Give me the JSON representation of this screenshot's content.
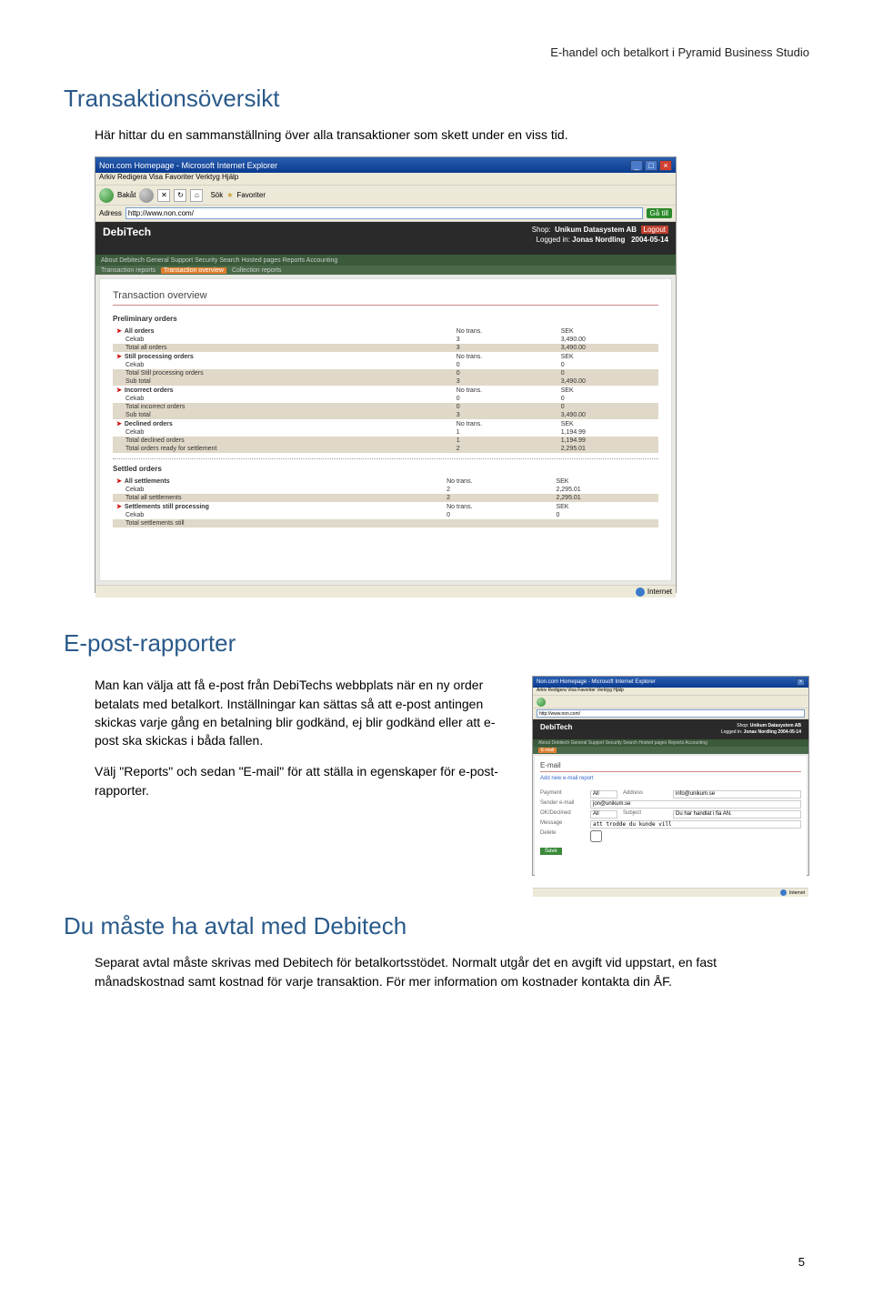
{
  "header_line": "E-handel och betalkort i Pyramid Business Studio",
  "section1": {
    "title": "Transaktionsöversikt",
    "body": "Här hittar du en sammanställning över alla transaktioner som skett under en viss tid."
  },
  "ie_window": {
    "title": "Non.com Homepage - Microsoft Internet Explorer",
    "menubar": "Arkiv  Redigera  Visa  Favoriter  Verktyg  Hjälp",
    "back": "Bakåt",
    "search": "Sök",
    "fav": "Favoriter",
    "address_label": "Adress",
    "address": "http://www.non.com/",
    "go": "Gå till",
    "status_net": "Internet"
  },
  "debitech": {
    "logo": "DebiTech",
    "shop_label": "Shop:",
    "shop": "Unikum Datasystem AB",
    "login_label": "Logged in:",
    "login": "Jonas Nordling",
    "date": "2004-05-14",
    "logout": "Logout",
    "nav": "About Debitech   General   Support   Security   Search   Hosted pages   Reports   Accounting",
    "subnav_a": "Transaction reports",
    "subnav_b": "Transaction overview",
    "subnav_c": "Collection reports"
  },
  "overview": {
    "title": "Transaction overview",
    "prelim": "Preliminary orders",
    "settled": "Settled orders",
    "col_notrans": "No trans.",
    "col_sek": "SEK",
    "rows": {
      "all_orders": "All orders",
      "cekab": "Cekab",
      "total_all": "Total all orders",
      "still_proc": "Still processing orders",
      "total_still": "Total Still processing orders",
      "sub_total": "Sub total",
      "incorrect": "Incorrect orders",
      "total_incorrect": "Total incorrect orders",
      "declined": "Declined orders",
      "total_declined": "Total declined orders",
      "total_ready": "Total orders ready for settlement",
      "all_settlements": "All settlements",
      "total_all_sett": "Total all settlements",
      "sett_proc": "Settlements still processing",
      "total_sett_still": "Total settlements still"
    },
    "v": {
      "three": "3",
      "zero": "0",
      "one": "1",
      "two": "2",
      "a3490": "3,490.00",
      "a0": "0",
      "a1194": "1,194.99",
      "a2295": "2,295.01"
    }
  },
  "section2": {
    "title": "E-post-rapporter",
    "p1": "Man kan välja att få e-post från DebiTechs webbplats när en ny order betalats med betalkort. Inställningar kan sättas så att e-post antingen skickas varje gång en betalning blir godkänd, ej blir godkänd eller att e-post ska skickas i båda fallen.",
    "p2": "Välj \"Reports\" och sedan \"E-mail\" för att ställa in egenskaper för e-post-rapporter."
  },
  "email_form": {
    "title": "E-mail",
    "add_link": "Add new e-mail report",
    "payment_lbl": "Payment",
    "payment_val": "All",
    "address_lbl": "Address",
    "address_val": "info@unikum.se",
    "sender_lbl": "Sender e-mail",
    "sender_val": "jon@unikum.se",
    "decline_lbl": "OK/Declined",
    "decline_val": "All",
    "subject_lbl": "Subject",
    "subject_val": "Du har handlat i fia AN.",
    "message_lbl": "Message",
    "message_val": "att trodde du kunde vill",
    "delete_lbl": "Delete",
    "save": "Save"
  },
  "section3": {
    "title": "Du måste ha avtal med Debitech",
    "body": "Separat avtal måste skrivas med Debitech för betalkortsstödet. Normalt utgår det en avgift vid uppstart, en fast månadskostnad samt kostnad för varje transaktion. För mer information om kostnader kontakta din ÅF."
  },
  "page_number": "5"
}
